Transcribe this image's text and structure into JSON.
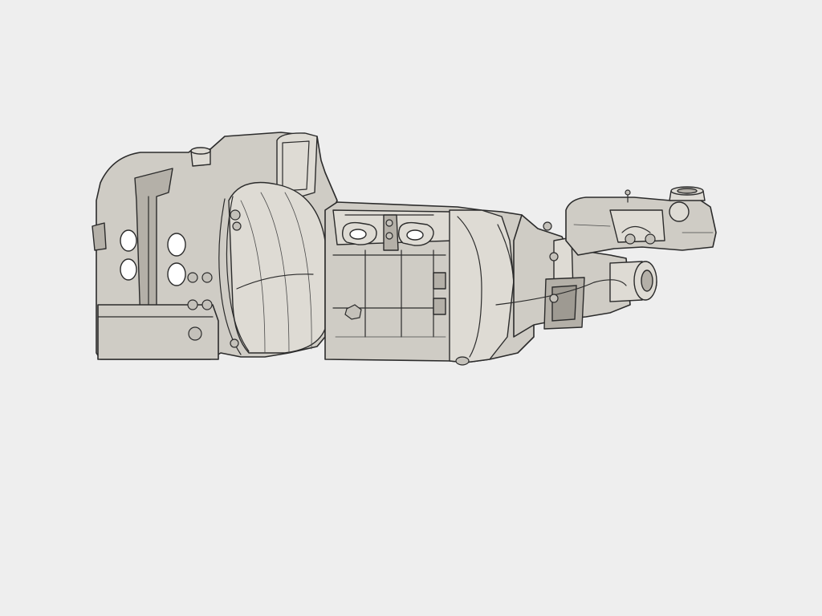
{
  "viewport": {
    "background": "#eeeeee"
  },
  "model": {
    "shade_color": "#cfccc5",
    "edge_color": "#2b2b2b",
    "render_style": "shaded-with-edges"
  }
}
